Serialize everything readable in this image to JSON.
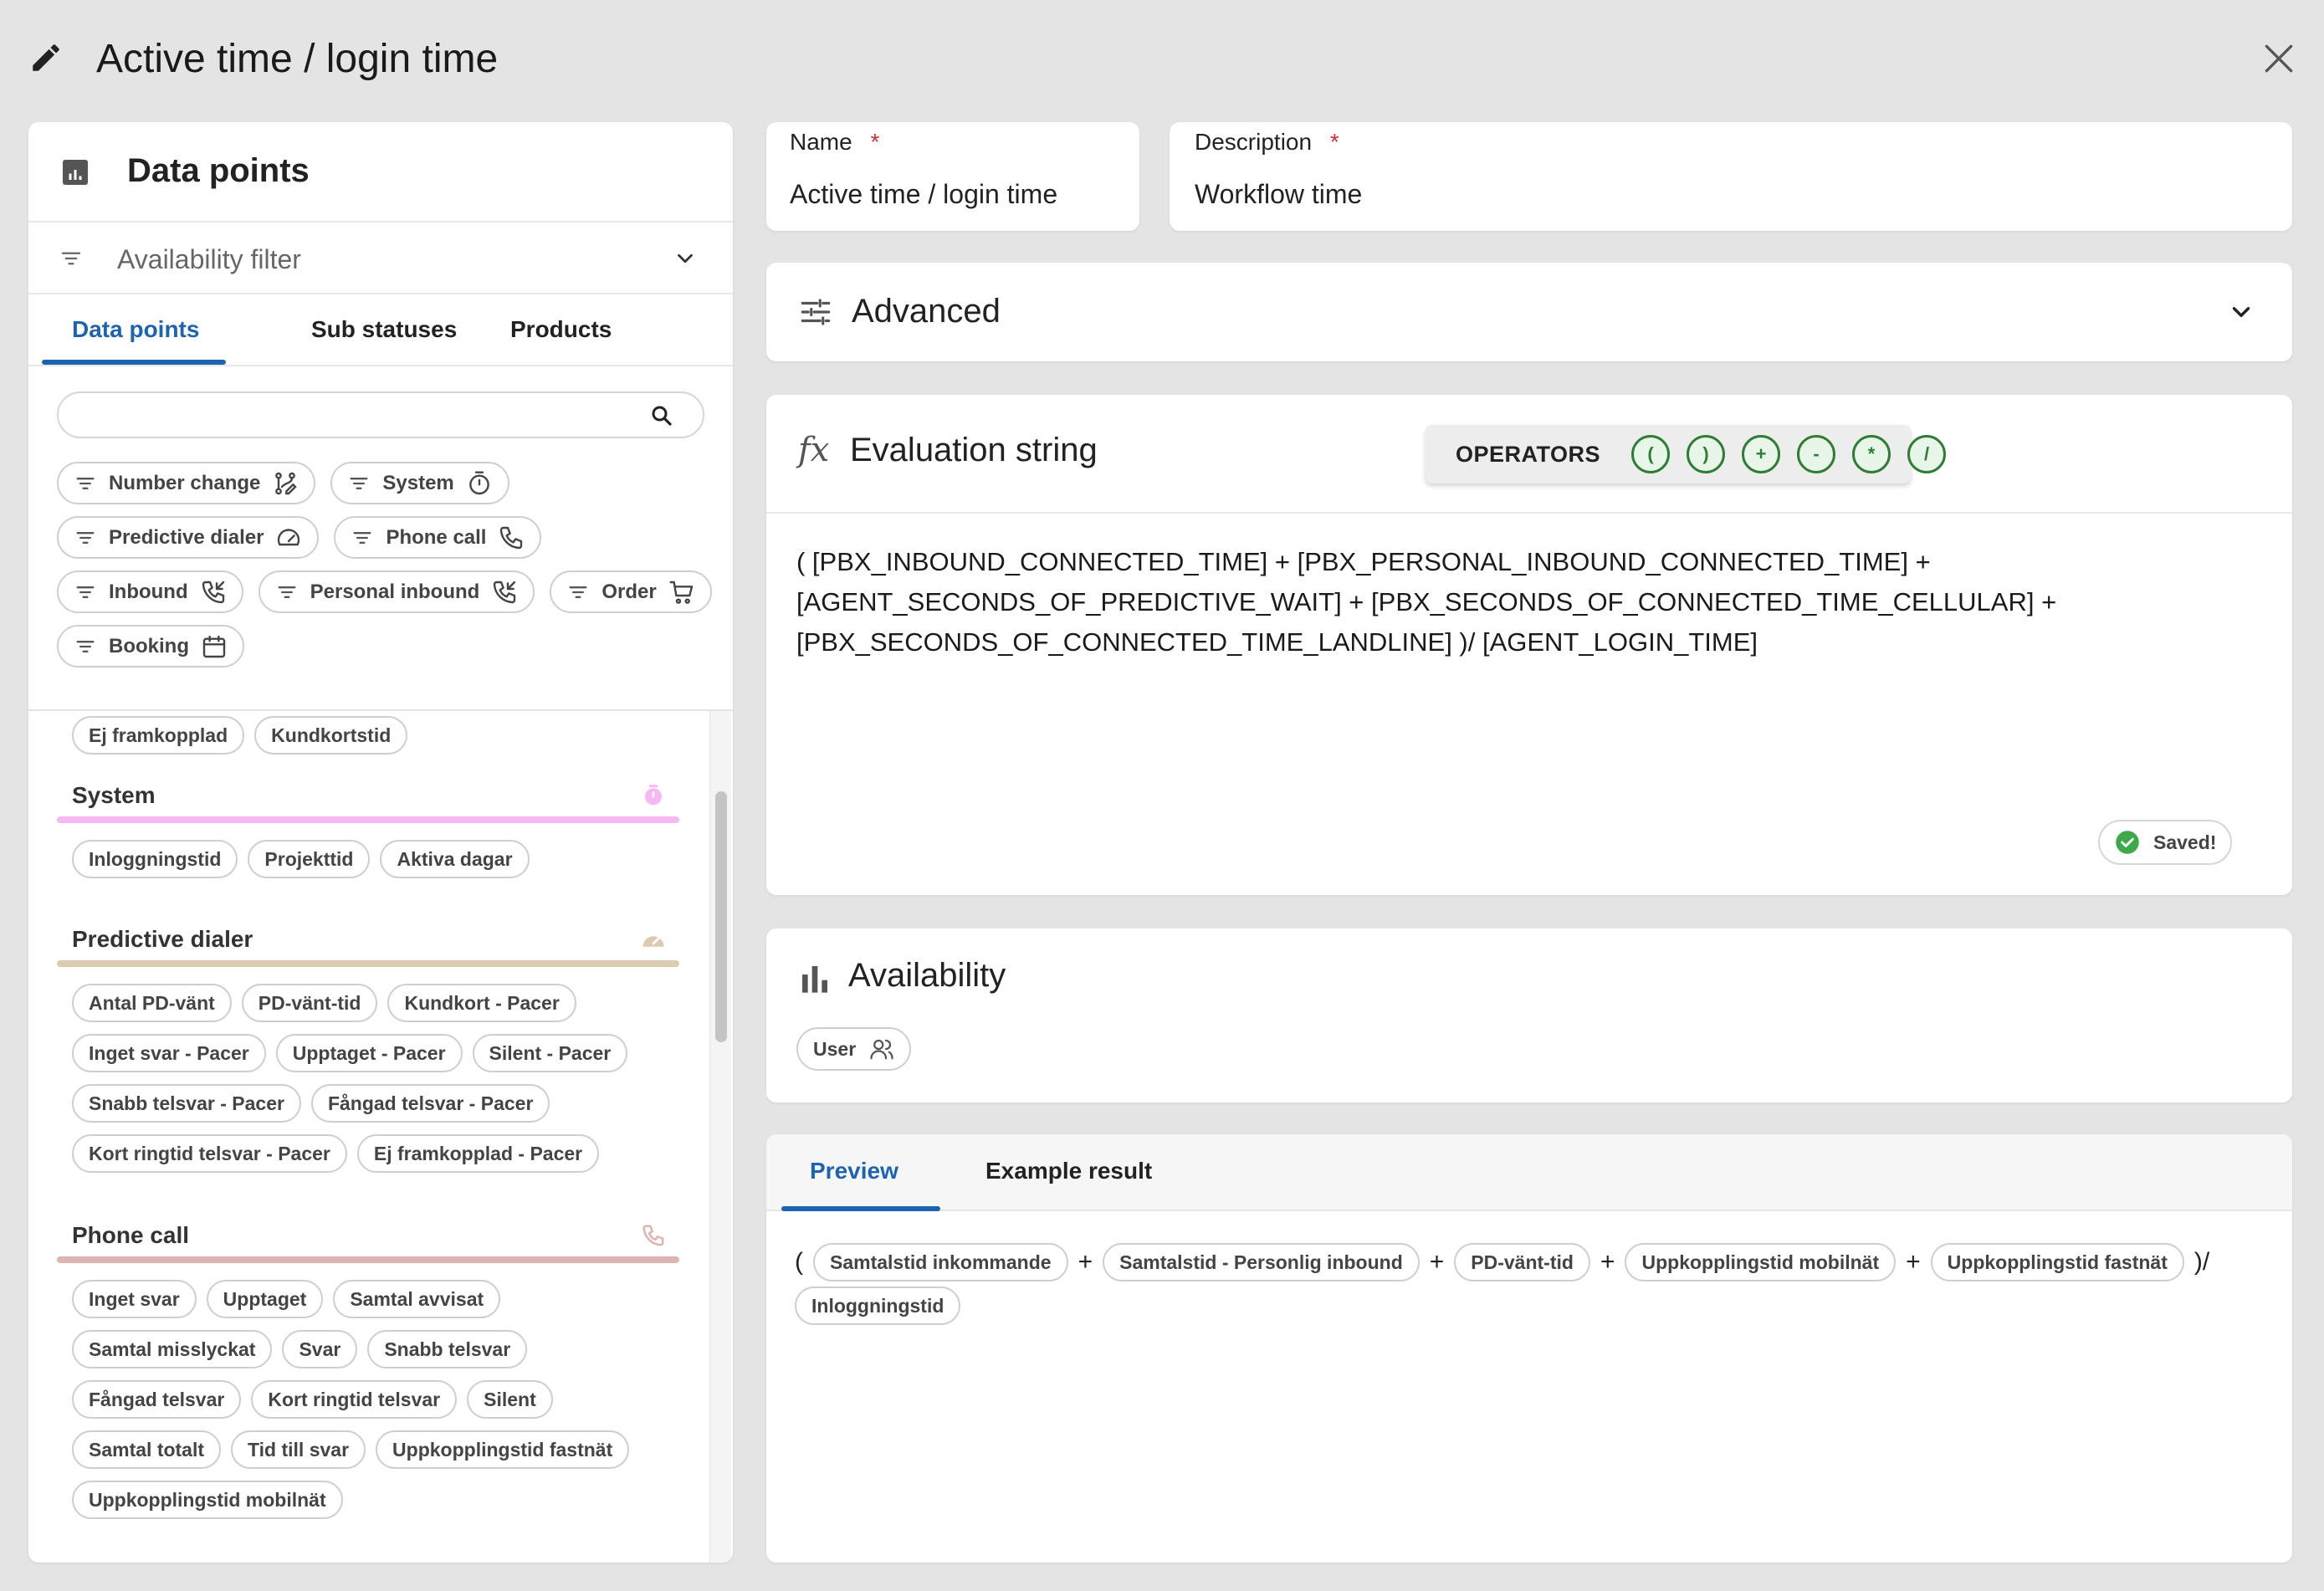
{
  "dialog": {
    "title": "Active time / login time"
  },
  "left_panel": {
    "title": "Data points",
    "availability_filter": "Availability filter",
    "tabs": [
      "Data points",
      "Sub statuses",
      "Products"
    ],
    "search": {
      "value": "",
      "placeholder": ""
    },
    "filter_chips": [
      {
        "label": "Number change",
        "icon": "number-change-icon"
      },
      {
        "label": "System",
        "icon": "timer-icon"
      },
      {
        "label": "Predictive dialer",
        "icon": "gauge-icon"
      },
      {
        "label": "Phone call",
        "icon": "phone-icon"
      },
      {
        "label": "Inbound",
        "icon": "phone-incoming-icon"
      },
      {
        "label": "Personal inbound",
        "icon": "phone-incoming-icon"
      },
      {
        "label": "Order",
        "icon": "cart-icon"
      },
      {
        "label": "Booking",
        "icon": "calendar-icon"
      }
    ],
    "top_pills": [
      "Ej framkopplad",
      "Kundkortstid"
    ],
    "sections": [
      {
        "title": "System",
        "color": "#f6b8f2",
        "icon": "timer-icon",
        "items": [
          "Inloggningstid",
          "Projekttid",
          "Aktiva dagar"
        ]
      },
      {
        "title": "Predictive dialer",
        "color": "#dccbb0",
        "icon": "gauge-icon",
        "items": [
          "Antal PD-vänt",
          "PD-vänt-tid",
          "Kundkort - Pacer",
          "Inget svar - Pacer",
          "Upptaget - Pacer",
          "Silent - Pacer",
          "Snabb telsvar - Pacer",
          "Fångad telsvar - Pacer",
          "Kort ringtid telsvar - Pacer",
          "Ej framkopplad - Pacer"
        ]
      },
      {
        "title": "Phone call",
        "color": "#ddb3b3",
        "icon": "phone-icon",
        "items": [
          "Inget svar",
          "Upptaget",
          "Samtal avvisat",
          "Samtal misslyckat",
          "Svar",
          "Snabb telsvar",
          "Fångad telsvar",
          "Kort ringtid telsvar",
          "Silent",
          "Samtal totalt",
          "Tid till svar",
          "Uppkopplingstid fastnät",
          "Uppkopplingstid mobilnät"
        ]
      }
    ]
  },
  "name_field": {
    "label": "Name",
    "required": "*",
    "value": "Active time / login time"
  },
  "description_field": {
    "label": "Description",
    "required": "*",
    "value": "Workflow time"
  },
  "advanced": {
    "title": "Advanced"
  },
  "evaluation": {
    "title": "Evaluation string",
    "operators_label": "OPERATORS",
    "operators": [
      "(",
      ")",
      "+",
      "-",
      "*",
      "/"
    ],
    "lines": [
      "( [PBX_INBOUND_CONNECTED_TIME] + [PBX_PERSONAL_INBOUND_CONNECTED_TIME] +",
      "[AGENT_SECONDS_OF_PREDICTIVE_WAIT] + [PBX_SECONDS_OF_CONNECTED_TIME_CELLULAR] +",
      "[PBX_SECONDS_OF_CONNECTED_TIME_LANDLINE] )/ [AGENT_LOGIN_TIME]"
    ],
    "saved_label": "Saved!"
  },
  "availability": {
    "title": "Availability",
    "user_chip": "User"
  },
  "preview": {
    "tabs": [
      "Preview",
      "Example result"
    ],
    "tokens": [
      {
        "kind": "sym",
        "text": "("
      },
      {
        "kind": "pill",
        "text": "Samtalstid inkommande"
      },
      {
        "kind": "sym",
        "text": "+"
      },
      {
        "kind": "pill",
        "text": "Samtalstid - Personlig inbound"
      },
      {
        "kind": "sym",
        "text": "+"
      },
      {
        "kind": "pill",
        "text": "PD-vänt-tid"
      },
      {
        "kind": "sym",
        "text": "+"
      },
      {
        "kind": "pill",
        "text": "Uppkopplingstid mobilnät"
      },
      {
        "kind": "sym",
        "text": "+"
      },
      {
        "kind": "pill",
        "text": "Uppkopplingstid fastnät"
      },
      {
        "kind": "sym",
        "text": ")/"
      },
      {
        "kind": "pill",
        "text": "Inloggningstid"
      }
    ]
  },
  "colors": {
    "accent": "#1e63b0",
    "success": "#3daa4a",
    "operator": "#2e7d32"
  }
}
